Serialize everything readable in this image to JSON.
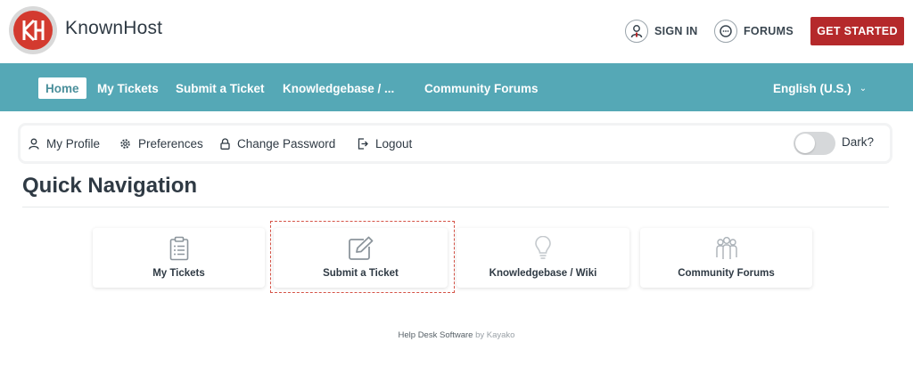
{
  "header": {
    "brand": "KnownHost",
    "logo_letters": "KH",
    "sign_in": "SIGN IN",
    "forums": "FORUMS",
    "get_started": "GET STARTED",
    "accent_color": "#b5292b"
  },
  "nav": {
    "color": "#55a8b6",
    "items": [
      {
        "label": "Home",
        "active": true
      },
      {
        "label": "My Tickets"
      },
      {
        "label": "Submit a Ticket"
      },
      {
        "label": "Knowledgebase / ..."
      },
      {
        "label": "Community Forums"
      }
    ],
    "language": "English (U.S.)"
  },
  "profile_bar": {
    "my_profile": "My Profile",
    "preferences": "Preferences",
    "change_password": "Change Password",
    "logout": "Logout",
    "dark_label": "Dark?",
    "dark_enabled": false
  },
  "quick_nav": {
    "title": "Quick Navigation",
    "cards": [
      {
        "label": "My Tickets",
        "icon": "clipboard-icon"
      },
      {
        "label": "Submit a Ticket",
        "icon": "edit-icon",
        "highlighted": true
      },
      {
        "label": "Knowledgebase / Wiki",
        "icon": "lightbulb-icon"
      },
      {
        "label": "Community Forums",
        "icon": "people-icon"
      }
    ]
  },
  "footer": {
    "text": "Help Desk Software",
    "by": "by Kayako"
  }
}
